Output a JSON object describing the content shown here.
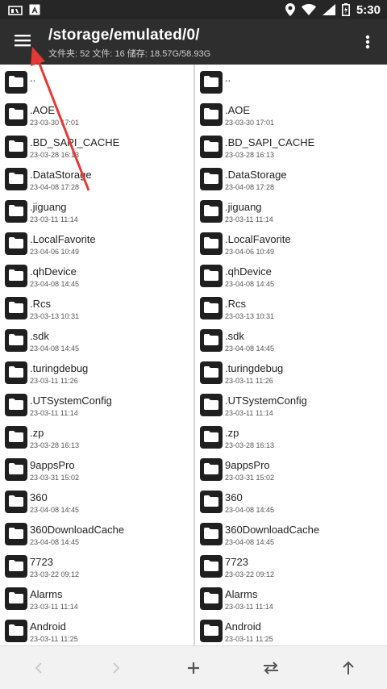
{
  "status_bar": {
    "time": "5:30",
    "icons": [
      "notification-icon",
      "app-icon",
      "location-icon",
      "wifi-icon",
      "signal-icon",
      "battery-icon"
    ]
  },
  "toolbar": {
    "title": "/storage/emulated/0/",
    "subtitle": "文件夹: 52  文件: 16  储存: 18.57G/58.93G",
    "menu_icon": "hamburger-menu-icon",
    "more_icon": "more-vert-icon"
  },
  "panes": {
    "left": [
      {
        "name": "..",
        "date": ""
      },
      {
        "name": ".AOE",
        "date": "23-03-30 17:01"
      },
      {
        "name": ".BD_SAPI_CACHE",
        "date": "23-03-28 16:13"
      },
      {
        "name": ".DataStorage",
        "date": "23-04-08 17:28"
      },
      {
        "name": ".jiguang",
        "date": "23-03-11 11:14"
      },
      {
        "name": ".LocalFavorite",
        "date": "23-04-06 10:49"
      },
      {
        "name": ".qhDevice",
        "date": "23-04-08 14:45"
      },
      {
        "name": ".Rcs",
        "date": "23-03-13 10:31"
      },
      {
        "name": ".sdk",
        "date": "23-04-08 14:45"
      },
      {
        "name": ".turingdebug",
        "date": "23-03-11 11:26"
      },
      {
        "name": ".UTSystemConfig",
        "date": "23-03-11 11:14"
      },
      {
        "name": ".zp",
        "date": "23-03-28 16:13"
      },
      {
        "name": "9appsPro",
        "date": "23-03-31 15:02"
      },
      {
        "name": "360",
        "date": "23-04-08 14:45"
      },
      {
        "name": "360DownloadCache",
        "date": "23-04-08 14:45"
      },
      {
        "name": "7723",
        "date": "23-03-22 09:12"
      },
      {
        "name": "Alarms",
        "date": "23-03-11 11:14"
      },
      {
        "name": "Android",
        "date": "23-03-11 11:25"
      }
    ],
    "right": [
      {
        "name": "..",
        "date": ""
      },
      {
        "name": ".AOE",
        "date": "23-03-30 17:01"
      },
      {
        "name": ".BD_SAPI_CACHE",
        "date": "23-03-28 16:13"
      },
      {
        "name": ".DataStorage",
        "date": "23-04-08 17:28"
      },
      {
        "name": ".jiguang",
        "date": "23-03-11 11:14"
      },
      {
        "name": ".LocalFavorite",
        "date": "23-04-06 10:49"
      },
      {
        "name": ".qhDevice",
        "date": "23-04-08 14:45"
      },
      {
        "name": ".Rcs",
        "date": "23-03-13 10:31"
      },
      {
        "name": ".sdk",
        "date": "23-04-08 14:45"
      },
      {
        "name": ".turingdebug",
        "date": "23-03-11 11:26"
      },
      {
        "name": ".UTSystemConfig",
        "date": "23-03-11 11:14"
      },
      {
        "name": ".zp",
        "date": "23-03-28 16:13"
      },
      {
        "name": "9appsPro",
        "date": "23-03-31 15:02"
      },
      {
        "name": "360",
        "date": "23-04-08 14:45"
      },
      {
        "name": "360DownloadCache",
        "date": "23-04-08 14:45"
      },
      {
        "name": "7723",
        "date": "23-03-22 09:12"
      },
      {
        "name": "Alarms",
        "date": "23-03-11 11:14"
      },
      {
        "name": "Android",
        "date": "23-03-11 11:25"
      }
    ]
  },
  "bottom_bar": {
    "buttons": [
      "back-arrow-icon",
      "forward-arrow-icon",
      "add-icon",
      "swap-icon",
      "up-arrow-icon"
    ]
  },
  "colors": {
    "toolbar_bg": "#2e2e2e",
    "status_bg": "#262626",
    "annotation_arrow": "#e53935"
  }
}
